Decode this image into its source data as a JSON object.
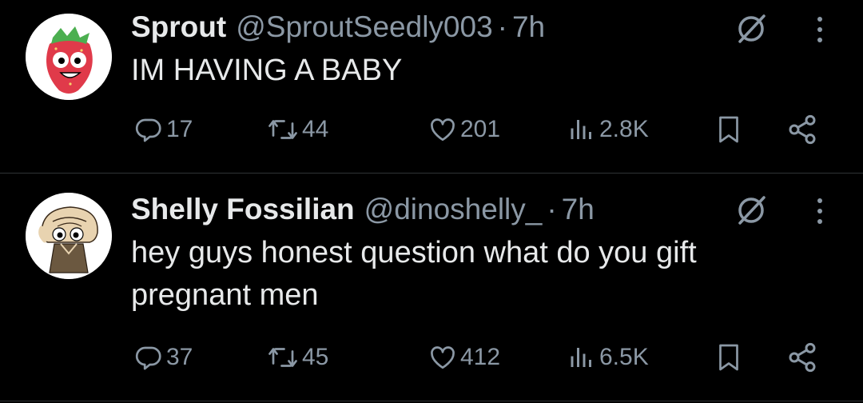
{
  "tweets": [
    {
      "display_name": "Sprout",
      "handle": "@SproutSeedly003",
      "separator": "·",
      "time": "7h",
      "text": "IM HAVING A BABY",
      "avatar_icon": "strawberry-character-avatar",
      "stats": {
        "replies": "17",
        "reposts": "44",
        "likes": "201",
        "views": "2.8K"
      }
    },
    {
      "display_name": "Shelly Fossilian",
      "handle": "@dinoshelly_",
      "separator": "·",
      "time": "7h",
      "text": "hey guys honest question what do you gift pregnant men",
      "avatar_icon": "fossil-character-avatar",
      "stats": {
        "replies": "37",
        "reposts": "45",
        "likes": "412",
        "views": "6.5K"
      }
    }
  ],
  "icons": {
    "reply": "reply-icon",
    "repost": "repost-icon",
    "like": "like-icon",
    "views": "views-icon",
    "bookmark": "bookmark-icon",
    "share": "share-icon",
    "grok": "grok-icon",
    "more": "more-icon"
  },
  "colors": {
    "background": "#000000",
    "primary_text": "#e7e9ea",
    "secondary_text": "#8b98a5",
    "divider": "#2f3336"
  }
}
